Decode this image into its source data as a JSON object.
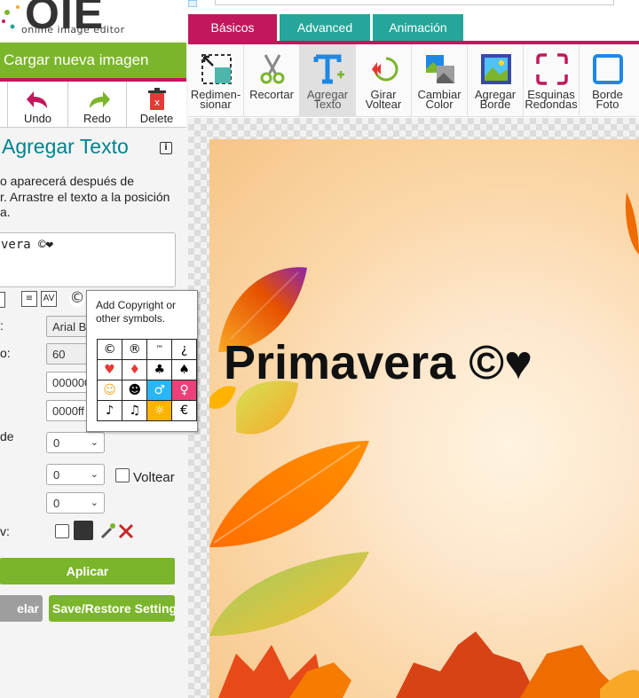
{
  "app": {
    "logo_text": "OIE",
    "logo_sub": "online image editor"
  },
  "left_panel": {
    "load_button": "Cargar nueva imagen",
    "undo": "Undo",
    "redo": "Redo",
    "delete": "Delete",
    "title": "Agregar Texto",
    "desc": [
      "o aparecerá después de",
      "r. Arrastre el texto a la posición",
      "a."
    ],
    "text_value": "vera ©❤",
    "labels": {
      "font": ":",
      "size": "o:",
      "angle": "de",
      "shadow": "v:"
    },
    "font_value": "Arial B",
    "size_value": "60",
    "color_value": "000000",
    "bg_value": "0000ff",
    "angle_select": "0",
    "select2": "0",
    "select3": "0",
    "flip_label": "Voltear",
    "apply": "Aplicar",
    "cancel": "elar",
    "save_restore": "Save/Restore Setting"
  },
  "tabs": [
    {
      "label": "Básicos",
      "color": "#c2185b"
    },
    {
      "label": "Advanced",
      "color": "#26a69a"
    },
    {
      "label": "Animación",
      "color": "#26a69a"
    }
  ],
  "tools": [
    {
      "l1": "Redimen-",
      "l2": "sionar"
    },
    {
      "l1": "Recortar",
      "l2": ""
    },
    {
      "l1": "Agregar",
      "l2": "Texto"
    },
    {
      "l1": "Girar",
      "l2": "Voltear"
    },
    {
      "l1": "Cambiar",
      "l2": "Color"
    },
    {
      "l1": "Agregar",
      "l2": "Borde"
    },
    {
      "l1": "Esquinas",
      "l2": "Redondas"
    },
    {
      "l1": "Borde",
      "l2": "Foto"
    }
  ],
  "canvas": {
    "text": "Primavera ©♥"
  },
  "popup": {
    "title": "Add Copyright or other symbols.",
    "symbols": [
      [
        "©",
        "®",
        "™",
        "¿"
      ],
      [
        "♥",
        "♦",
        "♣",
        "♠"
      ],
      [
        "☺",
        "☻",
        "♂",
        "♀"
      ],
      [
        "♪",
        "♫",
        "☼",
        "€"
      ]
    ]
  }
}
